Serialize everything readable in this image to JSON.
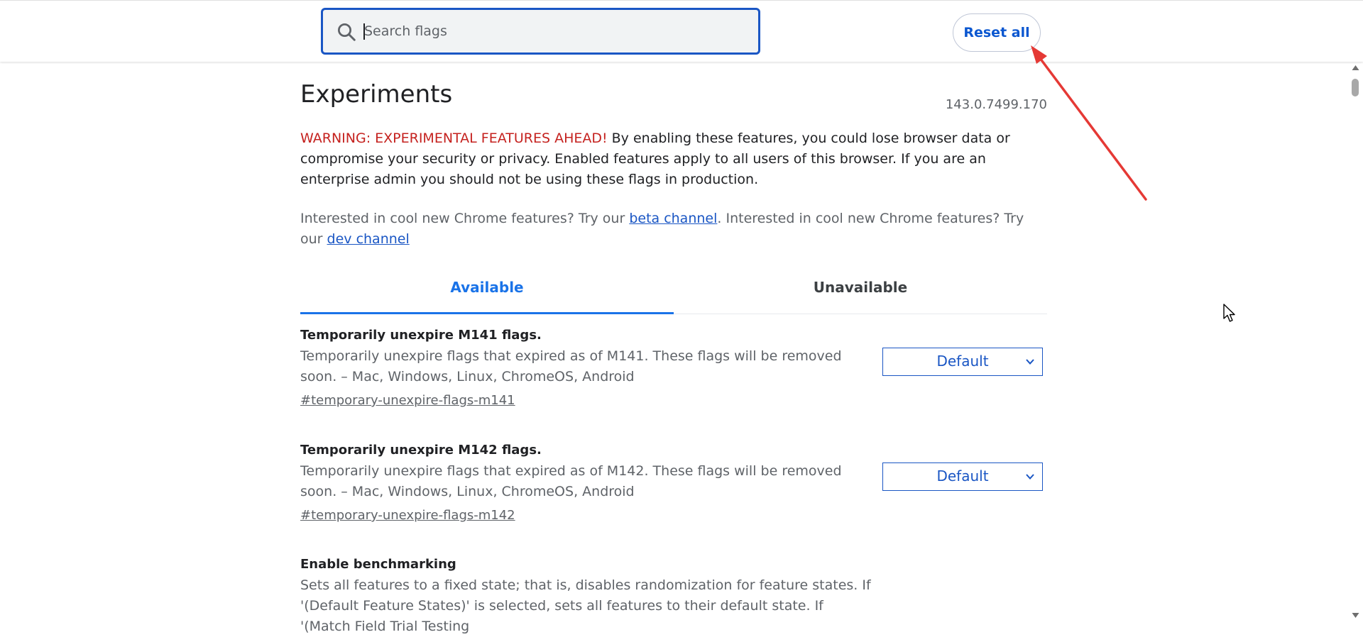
{
  "header": {
    "search": {
      "placeholder": "Search flags",
      "value": ""
    },
    "reset_all_label": "Reset all"
  },
  "page": {
    "title": "Experiments",
    "version": "143.0.7499.170",
    "warning_prefix": "WARNING: EXPERIMENTAL FEATURES AHEAD!",
    "warning_body": " By enabling these features, you could lose browser data or compromise your security or privacy. Enabled features apply to all users of this browser. If you are an enterprise admin you should not be using these flags in production.",
    "channels_text_1": "Interested in cool new Chrome features? Try our ",
    "beta_link": "beta channel",
    "channels_text_2": ". Interested in cool new Chrome features? Try our ",
    "dev_link": "dev channel"
  },
  "tabs": [
    {
      "label": "Available",
      "selected": true
    },
    {
      "label": "Unavailable",
      "selected": false
    }
  ],
  "flags": [
    {
      "title": "Temporarily unexpire M141 flags.",
      "description": "Temporarily unexpire flags that expired as of M141. These flags will be removed soon. – Mac, Windows, Linux, ChromeOS, Android",
      "link": "#temporary-unexpire-flags-m141",
      "value": "Default"
    },
    {
      "title": "Temporarily unexpire M142 flags.",
      "description": "Temporarily unexpire flags that expired as of M142. These flags will be removed soon. – Mac, Windows, Linux, ChromeOS, Android",
      "link": "#temporary-unexpire-flags-m142",
      "value": "Default"
    },
    {
      "title": "Enable benchmarking",
      "description": "Sets all features to a fixed state; that is, disables randomization for feature states. If '(Default Feature States)' is selected, sets all features to their default state. If '(Match Field Trial Testing"
    }
  ],
  "colors": {
    "accent": "#1a73e8",
    "link": "#1a56c4",
    "warning": "#c5221f",
    "annotation_arrow": "#e53935"
  }
}
